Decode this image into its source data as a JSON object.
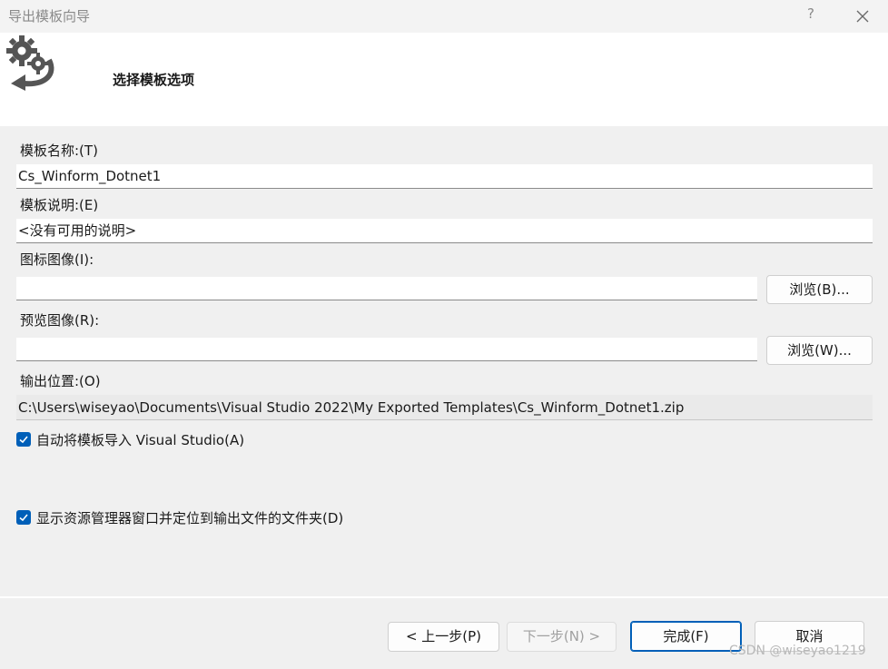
{
  "window": {
    "title": "导出模板向导",
    "help_glyph": "?",
    "close_icon": "close-icon"
  },
  "header": {
    "subtitle": "选择模板选项",
    "icon": "gear-export-icon"
  },
  "form": {
    "template_name_label": "模板名称:(T)",
    "template_name_value": "Cs_Winform_Dotnet1",
    "template_desc_label": "模板说明:(E)",
    "template_desc_value": "<没有可用的说明>",
    "icon_image_label": "图标图像(I):",
    "icon_image_value": "",
    "browse_icon_label": "浏览(B)...",
    "preview_image_label": "预览图像(R):",
    "preview_image_value": "",
    "browse_preview_label": "浏览(W)...",
    "output_location_label": "输出位置:(O)",
    "output_location_value": "C:\\Users\\wiseyao\\Documents\\Visual Studio 2022\\My Exported Templates\\Cs_Winform_Dotnet1.zip",
    "auto_import_label": "自动将模板导入 Visual Studio(A)",
    "auto_import_checked": true,
    "show_explorer_label": "显示资源管理器窗口并定位到输出文件的文件夹(D)",
    "show_explorer_checked": true
  },
  "footer": {
    "prev_label": "< 上一步(P)",
    "next_label": "下一步(N) >",
    "finish_label": "完成(F)",
    "cancel_label": "取消"
  },
  "watermark": "CSDN @wiseyao1219",
  "colors": {
    "accent": "#005fb8",
    "header_bg": "#ffffff",
    "body_bg": "#f0f0f0"
  }
}
